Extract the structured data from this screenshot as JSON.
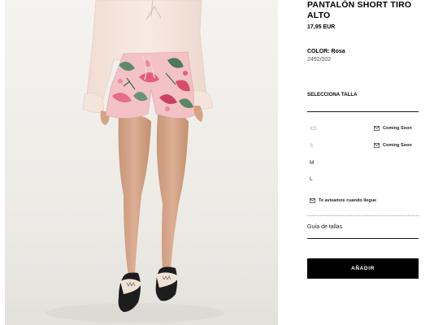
{
  "product": {
    "title": "PANTALÓN SHORT TIRO ALTO",
    "price": "17,95 EUR",
    "color_label": "COLOR: Rosa",
    "reference": "2492/002"
  },
  "sizes": {
    "header": "SELECCIONA TALLA",
    "options": [
      {
        "label": "XS",
        "available": false,
        "note": "Coming Soon"
      },
      {
        "label": "S",
        "available": false,
        "note": "Coming Soon"
      },
      {
        "label": "M",
        "available": true,
        "note": ""
      },
      {
        "label": "L",
        "available": true,
        "note": ""
      }
    ],
    "notify_text": "Te avisamos cuando llegue",
    "size_guide": "Guía de tallas"
  },
  "actions": {
    "add_label": "AÑADIR"
  },
  "icons": {
    "mail": "mail-icon"
  },
  "colors": {
    "button_bg": "#000000",
    "button_text": "#ffffff",
    "unavailable_text": "#aaaaaa",
    "photo_bg": "#efeeea"
  }
}
